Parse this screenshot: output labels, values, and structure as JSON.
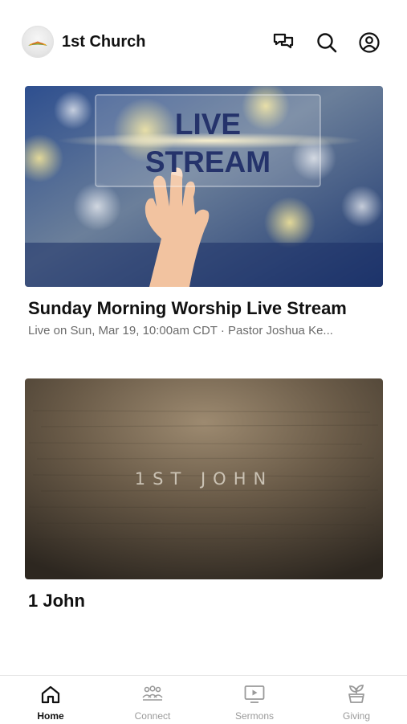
{
  "header": {
    "church_name": "1st Church",
    "icons": [
      "chat-icon",
      "search-icon",
      "account-icon"
    ]
  },
  "cards": [
    {
      "image_text_line1": "LIVE",
      "image_text_line2": "STREAM",
      "title": "Sunday Morning Worship Live Stream",
      "subtitle": "Live on Sun, Mar 19, 10:00am CDT · Pastor Joshua Ke..."
    },
    {
      "image_text": "1ST JOHN",
      "title": "1 John"
    }
  ],
  "tabs": [
    {
      "label": "Home",
      "icon": "home-icon",
      "active": true
    },
    {
      "label": "Connect",
      "icon": "people-icon",
      "active": false
    },
    {
      "label": "Sermons",
      "icon": "tv-play-icon",
      "active": false
    },
    {
      "label": "Giving",
      "icon": "plant-icon",
      "active": false
    }
  ],
  "colors": {
    "accent": "#111111",
    "inactive": "#9a9a9a",
    "live_text": "#25336b"
  }
}
